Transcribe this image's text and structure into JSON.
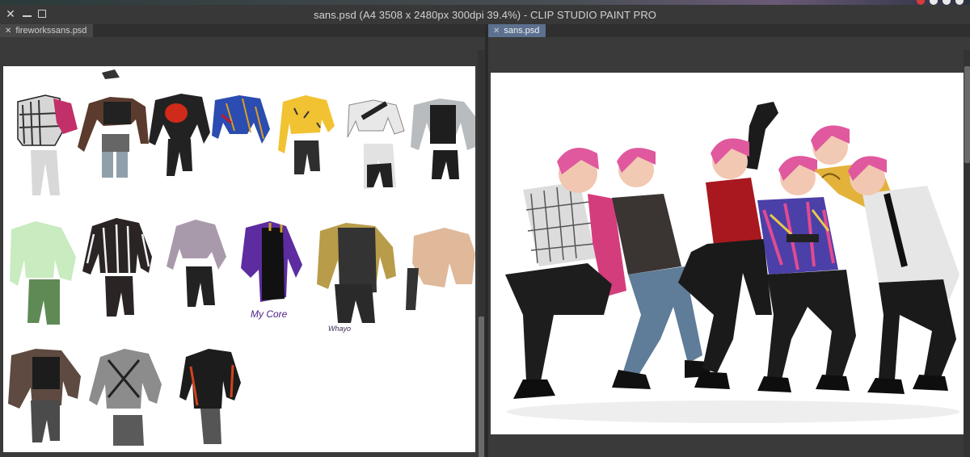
{
  "window": {
    "title": "sans.psd (A4 3508 x 2480px 300dpi 39.4%)  - CLIP STUDIO PAINT PRO",
    "controls": [
      "close-icon",
      "minimize-icon",
      "maximize-icon"
    ]
  },
  "tabs": {
    "left": "fireworkssans.psd",
    "right": "sans.psd"
  },
  "left_canvas": {
    "annotations": {
      "my_core": "My Core",
      "signature": "Whayo"
    }
  },
  "colors": {
    "chrome": "#3a3a3a",
    "titlebar": "#383838",
    "tab_active": "#5c7090",
    "paper": "#ffffff",
    "hair_pink": "#e0589e"
  }
}
